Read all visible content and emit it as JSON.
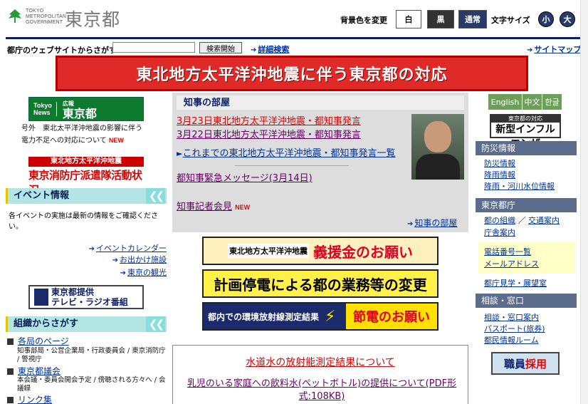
{
  "header": {
    "logo_small_lines": [
      "TOKYO",
      "METROPOLITAN",
      "GOVERNMENT"
    ],
    "logo_big": "東京都",
    "bg_label": "背景色を変更",
    "bg_white": "白",
    "bg_black": "黒",
    "bg_normal": "通常",
    "font_label": "文字サイズ",
    "font_small": "小",
    "font_large": "大",
    "colors": {
      "nav": "#0b1f66",
      "accent": "#e02a27"
    }
  },
  "search": {
    "label": "都庁のウェブサイトからさがす",
    "placeholder": "",
    "button": "検索開始",
    "advanced": "詳細検索",
    "sitemap": "サイトマップ"
  },
  "banner": {
    "text": "東北地方太平洋沖地震に伴う東京都の対応"
  },
  "left": {
    "kouhou_top": "広報",
    "kouhou_main": "東京都",
    "kouhou_en": [
      "Tokyo",
      "News"
    ],
    "notice_lines": [
      "号外　東北太平洋沖地震の影響に伴う",
      "電力不足への対応について"
    ],
    "new_badge": "NEW",
    "fire_head": "東北地方太平洋沖地震",
    "fire_text": "東京消防庁派遣隊活動状況",
    "event_title": "イベント情報",
    "event_desc": "各イベントの実施は最新の情報をご確認ください。",
    "event_links": [
      "イベントカレンダー",
      "お出かけ施設",
      "東京の観光"
    ],
    "tv_line1": "東京都提供",
    "tv_line2": "テレビ・ラジオ番組",
    "org_title": "組織からさがす",
    "org_items": [
      {
        "title": "各局のページ",
        "sub": "知事部局・公営企業局・行政委員会 / 東京消防庁 / 警視庁"
      },
      {
        "title": "東京都議会",
        "sub": "本会議・委員会開会予定 / 傍聴される方々へ / 会議録"
      },
      {
        "title": "リンク集"
      }
    ]
  },
  "governor": {
    "title": "知事の部屋",
    "links": [
      "3月23日東北地方太平洋沖地震・都知事発言",
      "3月22日東北地方太平洋沖地震・都知事発言",
      "これまでの東北地方太平洋沖地震・都知事発言一覧",
      "都知事緊急メッセージ(3月14日)",
      "知事記者会見"
    ],
    "new_badge": "NEW",
    "more": "知事の部屋"
  },
  "banners": {
    "b1_small": "東北地方太平洋沖地震",
    "b1_big": "義援金のお願い",
    "b2": "計画停電による都の業務等の変更",
    "b3_left": "都内での環境放射線測定結果",
    "b3_right": "節電のお願い"
  },
  "water": {
    "title": "水道水の放射能測定結果について",
    "link": "乳児のいる家庭への飲料水(ペットボトル)の提供について(PDF形式:108KB)"
  },
  "right": {
    "lang": [
      "English",
      "中文",
      "한글"
    ],
    "flu_small": "東京都の対応",
    "flu_big": "新型インフルエンザ",
    "bousai_title": "防災情報",
    "bousai_links": [
      "防災情報",
      "降雨情報",
      "降雨・河川水位情報"
    ],
    "tocho_title": "東京都庁",
    "tocho_links": [
      "都の組織",
      "交通案内",
      "庁舎案内",
      "電話番号一覧",
      "メールアドレス",
      "都庁見学・展望室"
    ],
    "soudan_title": "相談・窓口",
    "soudan_links": [
      "相談・窓口案内",
      "パスポート(旅券)",
      "都民情報ルーム"
    ],
    "shokuin_a": "職員",
    "shokuin_b": "採用"
  }
}
